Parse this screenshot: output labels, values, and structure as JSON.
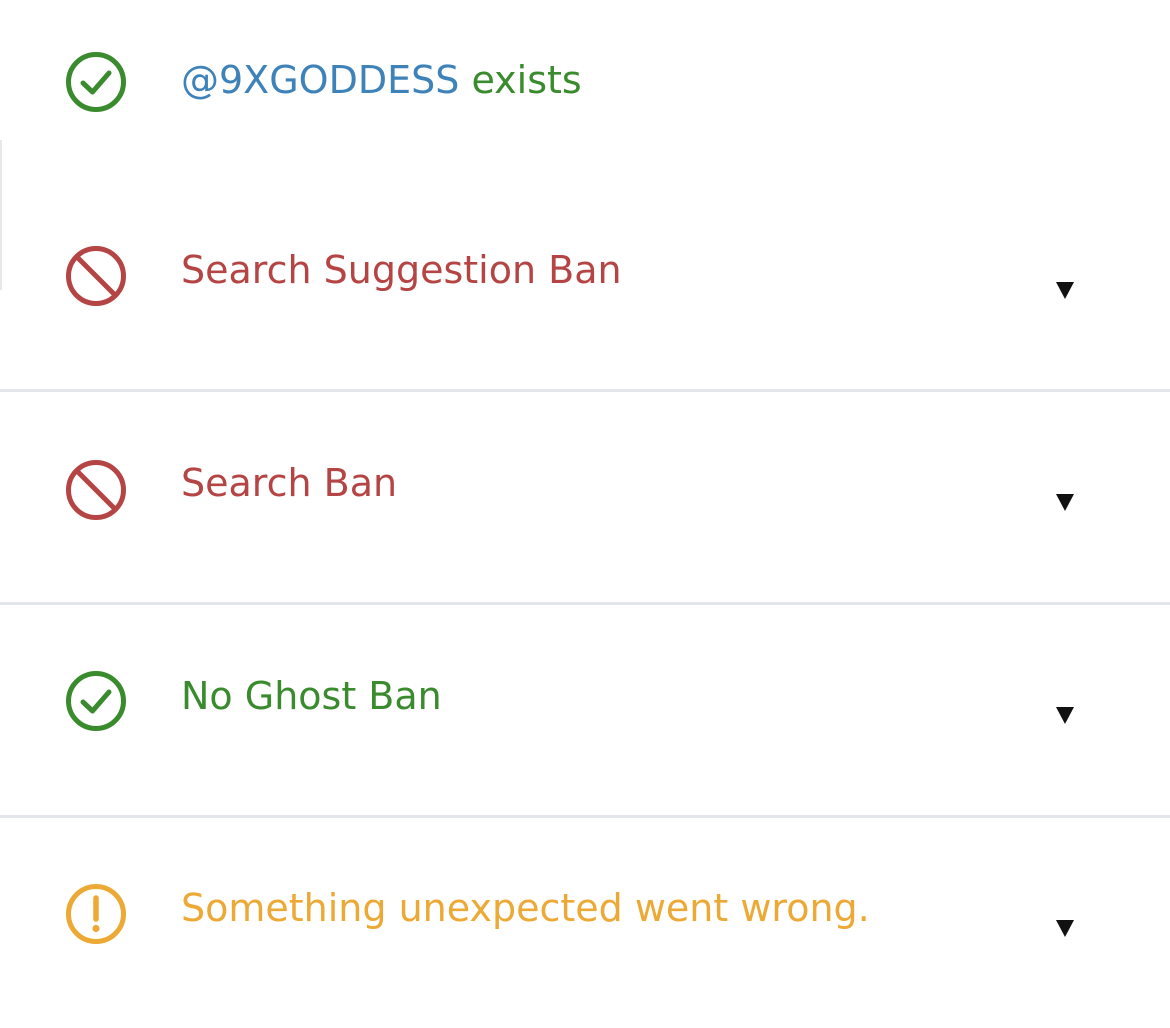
{
  "colors": {
    "ok": "#3a8a2e",
    "ban": "#b54545",
    "warn": "#eca935",
    "handle": "#3d82b9",
    "divider": "#e3e6ea"
  },
  "account": {
    "handle": "@9XGODDESS",
    "status_text": "exists",
    "icon": "check-circle-icon"
  },
  "results": [
    {
      "label": "Search Suggestion Ban",
      "status": "ban",
      "icon": "prohibited-icon",
      "expand_icon": "caret-down-icon"
    },
    {
      "label": "Search Ban",
      "status": "ban",
      "icon": "prohibited-icon",
      "expand_icon": "caret-down-icon"
    },
    {
      "label": "No Ghost Ban",
      "status": "ok",
      "icon": "check-circle-icon",
      "expand_icon": "caret-down-icon"
    },
    {
      "label": "Something unexpected went wrong.",
      "status": "warn",
      "icon": "exclamation-circle-icon",
      "expand_icon": "caret-down-icon"
    }
  ]
}
